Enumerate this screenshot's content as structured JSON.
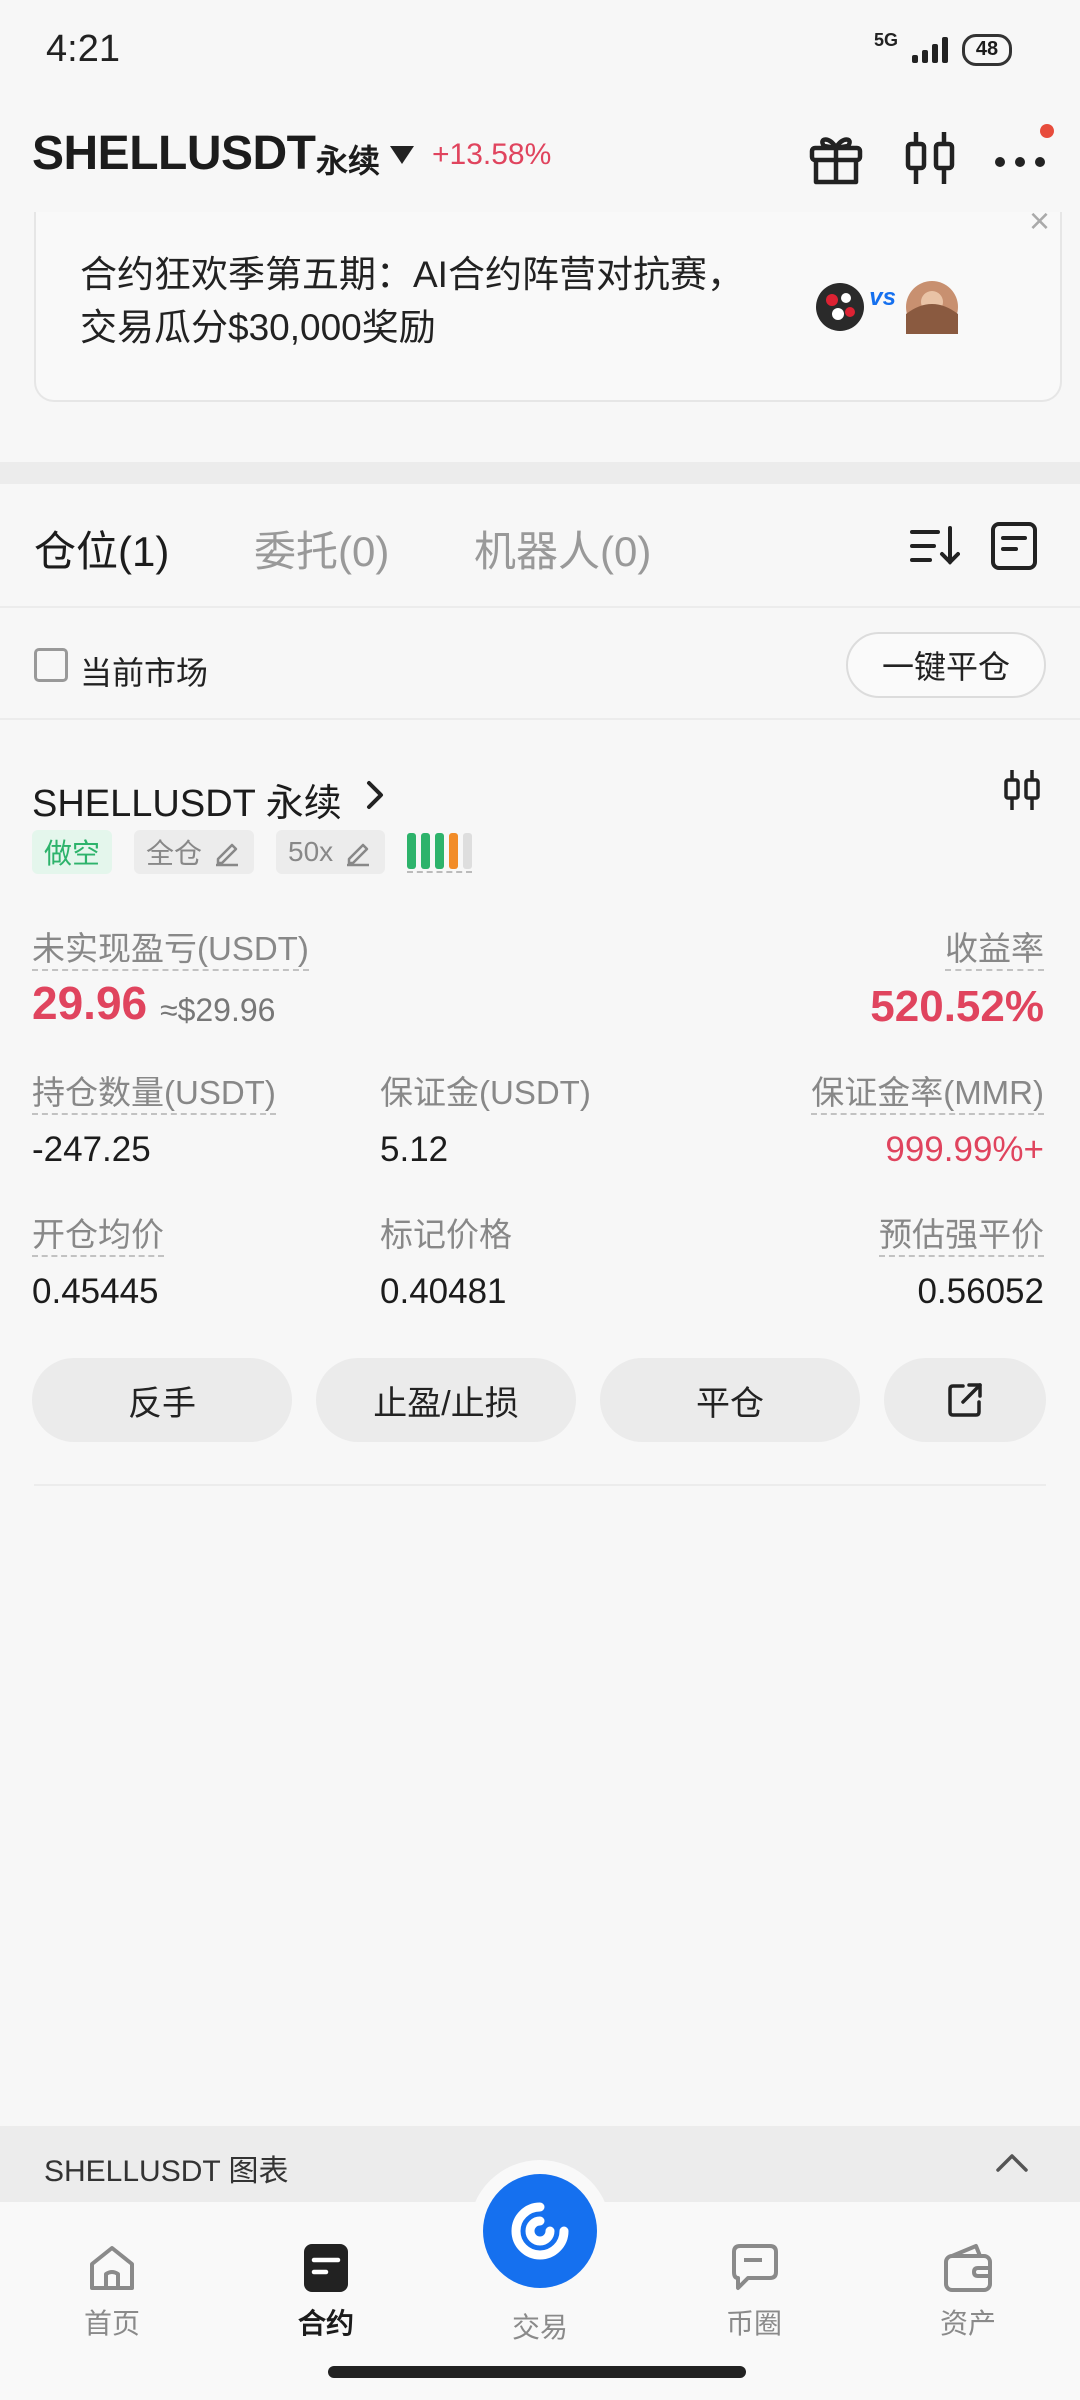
{
  "status_bar": {
    "time": "4:21",
    "network": "5G",
    "battery": "48"
  },
  "header": {
    "symbol": "SHELLUSDT",
    "contract_type": "永续",
    "change_pct": "+13.58%"
  },
  "banner": {
    "text": "合约狂欢季第五期：AI合约阵营对抗赛，交易瓜分$30,000奖励",
    "vs_text": "vs",
    "close": "×"
  },
  "tabs": [
    {
      "label": "仓位(1)",
      "active": true
    },
    {
      "label": "委托(0)",
      "active": false
    },
    {
      "label": "机器人(0)",
      "active": false
    }
  ],
  "filter": {
    "checkbox_label": "当前市场",
    "close_all": "一键平仓"
  },
  "position": {
    "symbol": "SHELLUSDT 永续",
    "side_badge": "做空",
    "margin_mode_badge": "全仓",
    "leverage_badge": "50x",
    "risk_bar_colors": [
      "#2db36b",
      "#2db36b",
      "#2db36b",
      "#f28c28",
      "#dedede"
    ],
    "unrealized_pnl_label": "未实现盈亏(USDT)",
    "unrealized_pnl": "29.96",
    "unrealized_pnl_approx": "≈$29.96",
    "roe_label": "收益率",
    "roe": "520.52%",
    "size_label": "持仓数量(USDT)",
    "size": "-247.25",
    "margin_label": "保证金(USDT)",
    "margin": "5.12",
    "mmr_label": "保证金率(MMR)",
    "mmr": "999.99%+",
    "entry_price_label": "开仓均价",
    "entry_price": "0.45445",
    "mark_price_label": "标记价格",
    "mark_price": "0.40481",
    "liq_price_label": "预估强平价",
    "liq_price": "0.56052",
    "actions": {
      "reverse": "反手",
      "tpsl": "止盈/止损",
      "close": "平仓"
    }
  },
  "chart_strip": {
    "label": "SHELLUSDT 图表"
  },
  "nav": [
    {
      "label": "首页",
      "icon": "home-icon",
      "active": false
    },
    {
      "label": "合约",
      "icon": "futures-icon",
      "active": true
    },
    {
      "label": "交易",
      "icon": "trade-icon",
      "active": false
    },
    {
      "label": "币圈",
      "icon": "community-icon",
      "active": false
    },
    {
      "label": "资产",
      "icon": "wallet-icon",
      "active": false
    }
  ],
  "colors": {
    "accent": "#1570ef",
    "loss_red": "#e0445e",
    "short_green": "#2db36b"
  }
}
